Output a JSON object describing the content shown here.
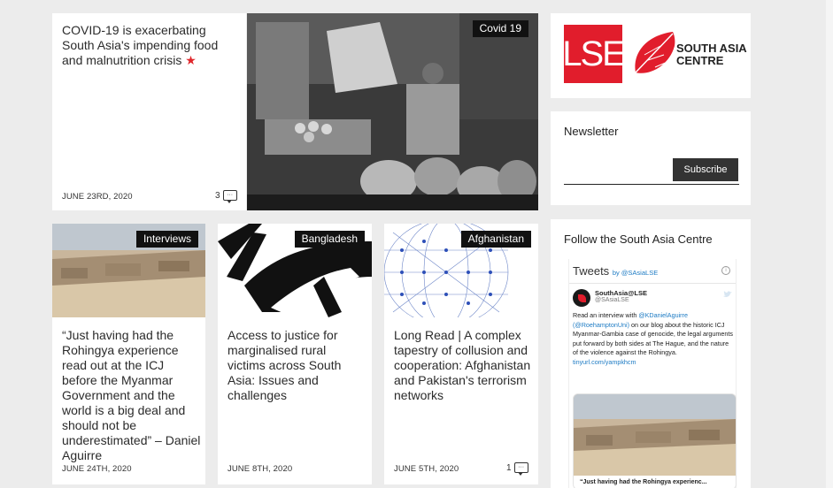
{
  "featured": {
    "title": "COVID-19 is exacerbating South Asia's impending food and malnutrition crisis",
    "star": "★",
    "date": "JUNE 23RD, 2020",
    "comments": "3",
    "tag": "Covid 19"
  },
  "articles": [
    {
      "tag": "Interviews",
      "title": "“Just having had the Rohingya experience read out at the ICJ before the Myanmar Government and the world is a big deal and should not be underestimated” – Daniel Aguirre",
      "date": "JUNE 24TH, 2020",
      "comments": ""
    },
    {
      "tag": "Bangladesh",
      "title": "Access to justice for marginalised rural victims across South Asia: Issues and challenges",
      "date": "JUNE 8TH, 2020",
      "comments": ""
    },
    {
      "tag": "Afghanistan",
      "title": "Long Read | A complex tapestry of collusion and cooperation: Afghanistan and Pakistan's terrorism networks",
      "date": "JUNE 5TH, 2020",
      "comments": "1"
    }
  ],
  "sidebar": {
    "logo_lse": "LSE",
    "logo_line1": "SOUTH ASIA",
    "logo_line2": "CENTRE",
    "newsletter_title": "Newsletter",
    "subscribe_label": "Subscribe",
    "follow_title": "Follow the South Asia Centre",
    "tweets_label": "Tweets",
    "tweets_by": "by @SAsiaLSE",
    "tweet_name": "SouthAsia@LSE",
    "tweet_handle": "@SAsiaLSE",
    "tweet_text_1": "Read an interview with",
    "tweet_mention_1": "@KDanielAguirre",
    "tweet_mention_2": "(@RoehamptonUni)",
    "tweet_text_2": "on our blog about the historic ICJ Myanmar-Gambia case of genocide, the legal arguments put forward by both sides at The Hague, and the nature of the violence against the Rohingya.",
    "tweet_link": "tinyurl.com/yampkhcm",
    "tweet_card_caption": "“Just having had the Rohingya experienc..."
  }
}
